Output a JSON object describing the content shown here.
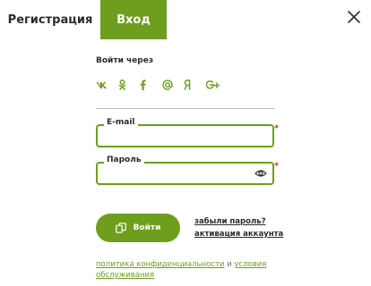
{
  "tabs": {
    "register": "Регистрация",
    "login": "Вход"
  },
  "social": {
    "title": "Войти через",
    "items": [
      {
        "name": "vk",
        "label": "vk"
      },
      {
        "name": "odnoklassniki",
        "label": "ok"
      },
      {
        "name": "facebook",
        "label": "f"
      },
      {
        "name": "mail",
        "label": "@"
      },
      {
        "name": "yandex",
        "label": "Я"
      },
      {
        "name": "google-plus",
        "label": "G+"
      }
    ]
  },
  "form": {
    "email_label": "E-mail",
    "password_label": "Пароль",
    "required_mark": "*"
  },
  "actions": {
    "login_button": "Войти",
    "forgot_password": "забыли пароль?",
    "activate_account": "активация аккаунта"
  },
  "terms": {
    "privacy": "политика конфиденциальности",
    "and": "и",
    "service": "условия обслуживания"
  },
  "colors": {
    "accent": "#6e9e1e",
    "required": "#d81e1e"
  }
}
